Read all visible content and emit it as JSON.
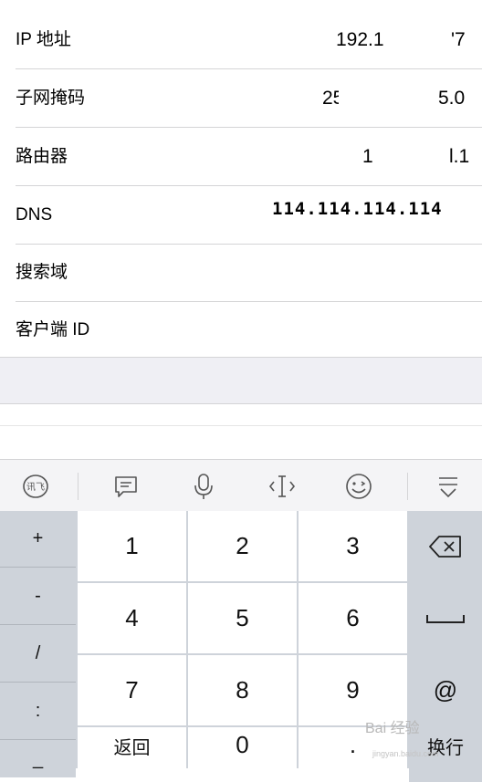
{
  "settings": {
    "rows": [
      {
        "label": "IP 地址",
        "value_a": "192.1",
        "value_b": "'7"
      },
      {
        "label": "子网掩码",
        "value_a": "25",
        "value_b": "5.0"
      },
      {
        "label": "路由器",
        "value_a": "1!",
        "value_b": "l.1"
      },
      {
        "label": "DNS",
        "value": "114.114.114.114"
      },
      {
        "label": "搜索域",
        "value": ""
      },
      {
        "label": "客户端 ID",
        "value": ""
      }
    ]
  },
  "toolbar": {
    "icons": [
      "xunfei-logo-icon",
      "chat-bubble-icon",
      "microphone-icon",
      "cursor-move-icon",
      "emoji-icon",
      "collapse-keyboard-icon"
    ],
    "logo_text": "讯飞"
  },
  "keyboard": {
    "side_keys": [
      "+",
      "-",
      "/",
      ":",
      "_"
    ],
    "number_keys": [
      "1",
      "2",
      "3",
      "4",
      "5",
      "6",
      "7",
      "8",
      "9"
    ],
    "return_label": "返回",
    "zero": "0",
    "dot": ".",
    "at": "@",
    "enter_label": "换行"
  },
  "watermark": {
    "text": "Bai 经验",
    "sub": "jingyan.baidu.com"
  }
}
